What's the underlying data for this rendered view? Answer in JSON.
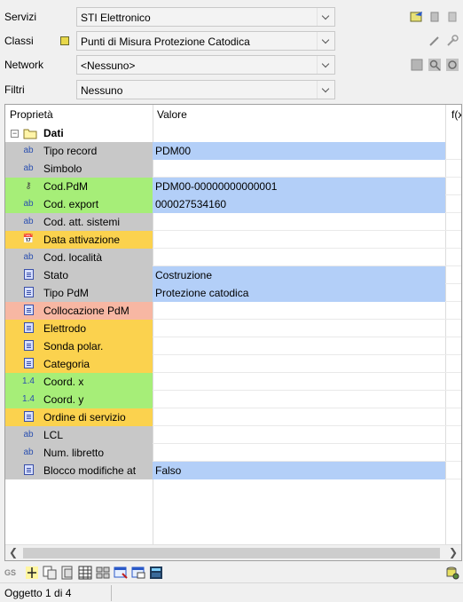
{
  "filters": {
    "servizi": {
      "label": "Servizi",
      "value": "STI Elettronico"
    },
    "classi": {
      "label": "Classi",
      "value": "Punti di Misura Protezione Catodica"
    },
    "network": {
      "label": "Network",
      "value": "<Nessuno>"
    },
    "filtri": {
      "label": "Filtri",
      "value": "Nessuno"
    }
  },
  "grid": {
    "headers": {
      "property": "Proprietà",
      "value": "Valore",
      "formula": "f(x"
    },
    "group": {
      "label": "Dati",
      "toggle": "−"
    },
    "rows": [
      {
        "icon": "ab",
        "label": "Tipo record",
        "value": "PDM00"
      },
      {
        "icon": "ab",
        "label": "Simbolo",
        "value": ""
      },
      {
        "icon": "key",
        "label": "Cod.PdM",
        "value": "PDM00-00000000000001"
      },
      {
        "icon": "ab",
        "label": "Cod. export",
        "value": "000027534160"
      },
      {
        "icon": "ab",
        "label": "Cod. att. sistemi",
        "value": ""
      },
      {
        "icon": "calendar",
        "label": "Data attivazione",
        "value": ""
      },
      {
        "icon": "ab",
        "label": "Cod. località",
        "value": ""
      },
      {
        "icon": "list",
        "label": "Stato",
        "value": "Costruzione"
      },
      {
        "icon": "list",
        "label": "Tipo PdM",
        "value": "Protezione catodica"
      },
      {
        "icon": "list",
        "label": "Collocazione PdM",
        "value": ""
      },
      {
        "icon": "list",
        "label": "Elettrodo",
        "value": ""
      },
      {
        "icon": "list",
        "label": "Sonda polar.",
        "value": ""
      },
      {
        "icon": "list",
        "label": "Categoria",
        "value": ""
      },
      {
        "icon": "1.4",
        "label": "Coord. x",
        "value": ""
      },
      {
        "icon": "1.4",
        "label": "Coord. y",
        "value": ""
      },
      {
        "icon": "list",
        "label": "Ordine di servizio",
        "value": ""
      },
      {
        "icon": "ab",
        "label": "LCL",
        "value": ""
      },
      {
        "icon": "ab",
        "label": "Num. libretto",
        "value": ""
      },
      {
        "icon": "list",
        "label": "Blocco modifiche at",
        "value": "Falso"
      }
    ]
  },
  "toolbar": {
    "gs_label": "GS"
  },
  "status": {
    "text": "Oggetto 1 di 4"
  },
  "colors": {
    "gray": "#c8c8c8",
    "green": "#a6ee78",
    "orange": "#fbd24e",
    "salmon": "#f7b7a3",
    "value_blue": "#b3cff8"
  }
}
